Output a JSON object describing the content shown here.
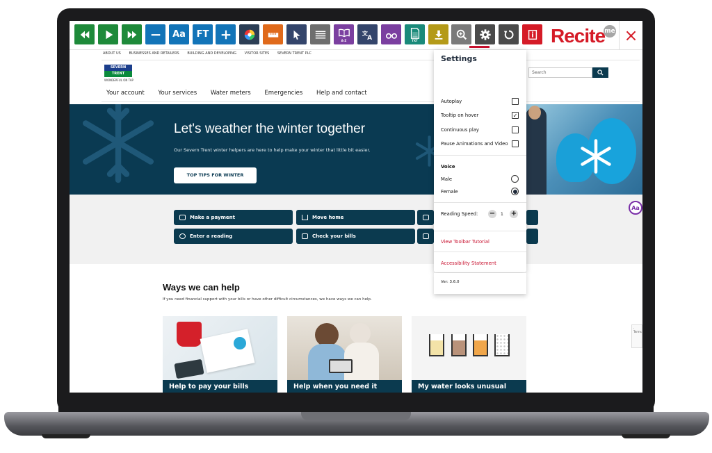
{
  "toolbar": {
    "buttons": [
      {
        "name": "rewind-button",
        "icon": "rewind-icon",
        "color": "#1e8a3a",
        "label": ""
      },
      {
        "name": "play-button",
        "icon": "play-icon",
        "color": "#1e8a3a",
        "label": ""
      },
      {
        "name": "fast-forward-button",
        "icon": "fast-forward-icon",
        "color": "#1e8a3a",
        "label": ""
      },
      {
        "name": "decrease-text-button",
        "icon": "minus-icon",
        "color": "#1274b8",
        "label": ""
      },
      {
        "name": "font-button",
        "icon": "font-icon",
        "color": "#1274b8",
        "label": "Aa"
      },
      {
        "name": "font-type-button",
        "icon": "font-type-icon",
        "color": "#1274b8",
        "label": "FT"
      },
      {
        "name": "increase-text-button",
        "icon": "plus-icon",
        "color": "#1274b8",
        "label": ""
      },
      {
        "name": "color-button",
        "icon": "color-wheel-icon",
        "color": "#2c3e55",
        "label": ""
      },
      {
        "name": "ruler-button",
        "icon": "ruler-icon",
        "color": "#e06a1b",
        "label": ""
      },
      {
        "name": "cursor-button",
        "icon": "cursor-icon",
        "color": "#34456b",
        "label": ""
      },
      {
        "name": "text-only-button",
        "icon": "text-lines-icon",
        "color": "#6e6e6e",
        "label": ""
      },
      {
        "name": "dictionary-button",
        "icon": "book-icon",
        "color": "#7b3fa0",
        "label": "A-Z"
      },
      {
        "name": "translate-button",
        "icon": "translate-icon",
        "color": "#34456b",
        "label": ""
      },
      {
        "name": "glasses-button",
        "icon": "glasses-icon",
        "color": "#7b3fa0",
        "label": ""
      },
      {
        "name": "text-mode-button",
        "icon": "document-icon",
        "color": "#1a8a7a",
        "label": "TXT"
      },
      {
        "name": "download-button",
        "icon": "download-icon",
        "color": "#b49a18",
        "label": ""
      },
      {
        "name": "magnifier-button",
        "icon": "magnifier-icon",
        "color": "#7a7a7a",
        "label": ""
      },
      {
        "name": "settings-button",
        "icon": "gear-icon",
        "color": "#4a4a4a",
        "label": ""
      },
      {
        "name": "reset-button",
        "icon": "reset-icon",
        "color": "#4a4a4a",
        "label": ""
      },
      {
        "name": "info-button",
        "icon": "info-icon",
        "color": "#d51b27",
        "label": ""
      }
    ],
    "logo": "Recite",
    "logo_badge": "me",
    "close_label": "×"
  },
  "site": {
    "util_links": [
      "ABOUT US",
      "BUSINESSES AND RETAILERS",
      "BUILDING AND DEVELOPING",
      "VISITOR SITES",
      "SEVERN TRENT PLC"
    ],
    "logo_top": "SEVERN",
    "logo_bottom": "TRENT",
    "logo_tagline": "WONDERFUL ON TAP",
    "search_placeholder": "Search",
    "nav": [
      "Your account",
      "Your services",
      "Water meters",
      "Emergencies",
      "Help and contact"
    ],
    "hero": {
      "title": "Let's weather the winter together",
      "subtitle": "Our Severn Trent winter helpers are here to help make your winter that little bit easier.",
      "button": "TOP TIPS FOR WINTER"
    },
    "quick_links": [
      "Make a payment",
      "Move home",
      "Enter a reading",
      "Check your bills"
    ],
    "ways": {
      "title": "Ways we can help",
      "subtitle": "If you need financial support with your bills or have other difficult circumstances, we have ways we can help."
    },
    "cards": [
      "Help to pay your bills",
      "Help when you need it",
      "My water looks unusual"
    ],
    "badge": "Aa",
    "recaptcha_text": "· Terms"
  },
  "settings": {
    "title": "Settings",
    "options": [
      {
        "label": "Autoplay",
        "checked": false
      },
      {
        "label": "Tooltip on hover",
        "checked": true
      },
      {
        "label": "Continuous play",
        "checked": false
      },
      {
        "label": "Pause Animations and Video",
        "checked": false
      }
    ],
    "voice_heading": "Voice",
    "voices": [
      {
        "label": "Male",
        "selected": false
      },
      {
        "label": "Female",
        "selected": true
      }
    ],
    "speed_label": "Reading Speed:",
    "speed_value": "1",
    "tutorial_link": "View Toolbar Tutorial",
    "statement_link": "Accessibility Statement",
    "version": "Ver: 3.6.0"
  }
}
